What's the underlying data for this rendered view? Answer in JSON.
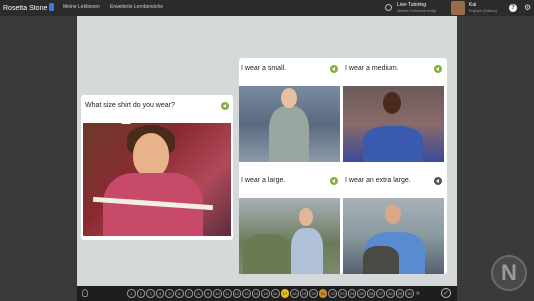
{
  "app": {
    "brand": "Rosetta Stone",
    "nav": [
      "Meine Lektionen",
      "Erweiterte Lernbereiche"
    ],
    "live_title": "Live-Tutoring",
    "live_sub": "Weitere Fortschritt erfolgt",
    "user_name": "Kai",
    "user_sub": "Englisch (Britisch)",
    "help": "?",
    "accent": "#7db43a",
    "active_step_color": "#f0b81a"
  },
  "lesson": {
    "prompt": "What size shirt do you wear?",
    "options": [
      {
        "label": "I wear a small."
      },
      {
        "label": "I wear a medium."
      },
      {
        "label": "I wear a large."
      },
      {
        "label": "I wear an extra large."
      }
    ]
  },
  "progress": {
    "steps": [
      "1",
      "2",
      "3",
      "4",
      "5",
      "6",
      "7",
      "8",
      "9",
      "10",
      "11",
      "12",
      "13",
      "14",
      "15",
      "16",
      "17",
      "18",
      "19",
      "20",
      "21",
      "22",
      "23",
      "24",
      "25",
      "26",
      "27",
      "28",
      "29",
      "30"
    ],
    "active": 17,
    "done": 21
  },
  "badge": "N"
}
